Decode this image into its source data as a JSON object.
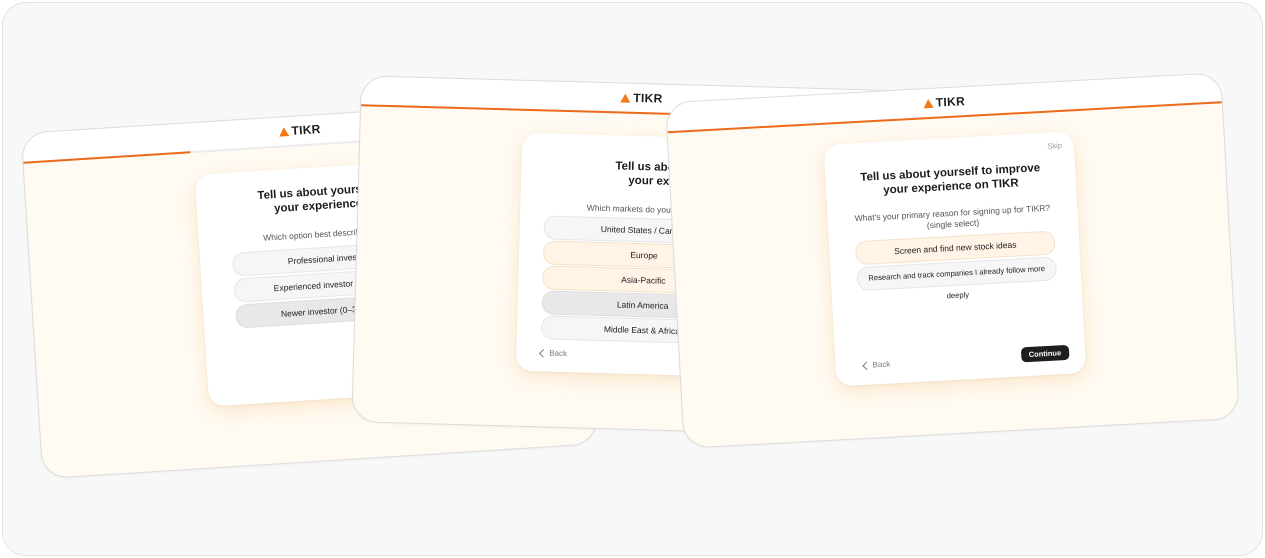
{
  "brand": {
    "name": "TIKR",
    "accent": "#ee6a1b"
  },
  "screens": [
    {
      "progress": 0.3,
      "title_line1": "Tell us about yourself to impro",
      "title_line2": "your experience on TIKR",
      "question": "Which option best describes your investing",
      "options": [
        {
          "label": "Professional investor",
          "state": "default"
        },
        {
          "label": "Experienced investor (3+ yea",
          "state": "default"
        },
        {
          "label": "Newer investor (0–3 years",
          "state": "selected-dark"
        }
      ]
    },
    {
      "progress": 1.0,
      "title_line1": "Tell us about yourself to",
      "title_line2": "your experience on",
      "question": "Which markets do you primarily invest",
      "options": [
        {
          "label": "United States / Canada",
          "state": "default"
        },
        {
          "label": "Europe",
          "state": "selected"
        },
        {
          "label": "Asia-Pacific",
          "state": "selected"
        },
        {
          "label": "Latin America",
          "state": "selected-dark"
        },
        {
          "label": "Middle East & Africa",
          "state": "default"
        }
      ],
      "back_label": "Back"
    },
    {
      "progress": 1.0,
      "skip_label": "Skip",
      "title_line1": "Tell us about yourself to improve",
      "title_line2": "your experience on TIKR",
      "question_line1": "What's your primary reason for signing up for TIKR?",
      "question_line2": "(single select)",
      "options": [
        {
          "label": "Screen and find new stock ideas",
          "state": "selected"
        },
        {
          "label": "Research and track companies I already follow more deeply",
          "state": "default"
        }
      ],
      "back_label": "Back",
      "continue_label": "Continue"
    }
  ]
}
